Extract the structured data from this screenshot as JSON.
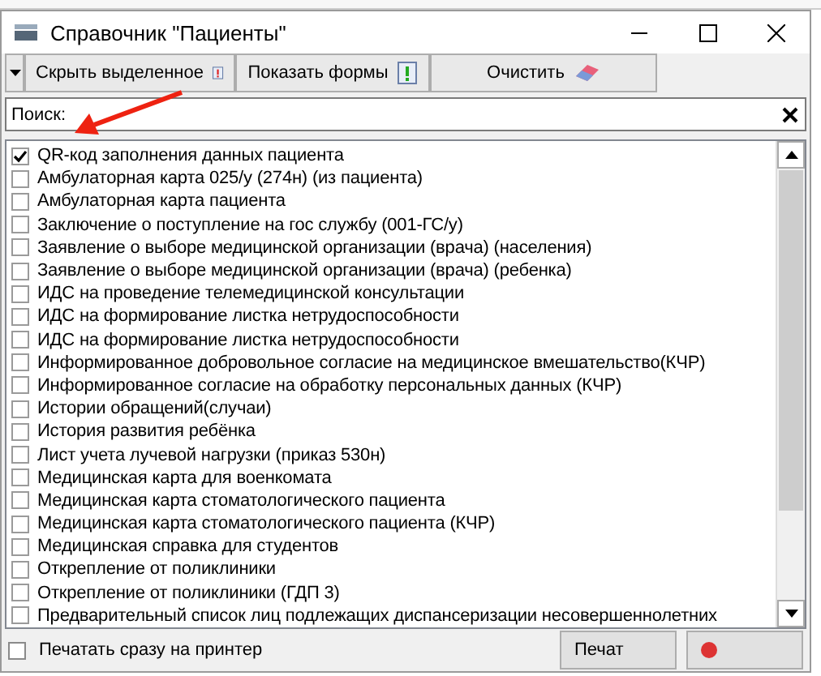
{
  "window": {
    "title": "Справочник \"Пациенты\""
  },
  "toolbar": [
    {
      "label": "Скрыть выделенное",
      "kind": "hide"
    },
    {
      "label": "Показать формы",
      "kind": "show"
    },
    {
      "label": "Очистить",
      "kind": "clear"
    }
  ],
  "search": {
    "label": "Поиск:"
  },
  "items": [
    {
      "label": "QR-код заполнения данных пациента",
      "checked": true
    },
    {
      "label": "Амбулаторная карта 025/у (274н) (из пациента)",
      "checked": false
    },
    {
      "label": "Амбулаторная карта пациента",
      "checked": false
    },
    {
      "label": "Заключение о поступление на гос службу (001-ГС/у)",
      "checked": false
    },
    {
      "label": "Заявление о выборе медицинской организации (врача) (населения)",
      "checked": false
    },
    {
      "label": "Заявление о выборе медицинской организации (врача) (ребенка)",
      "checked": false
    },
    {
      "label": "ИДС на проведение телемедицинской консультации",
      "checked": false
    },
    {
      "label": "ИДС на формирование листка нетрудоспособности",
      "checked": false
    },
    {
      "label": "ИДС на формирование листка нетрудоспособности",
      "checked": false
    },
    {
      "label": "Информированное добровольное согласие на медицинское вмешательство(КЧР)",
      "checked": false
    },
    {
      "label": "Информированное согласие на обработку персональных данных (КЧР)",
      "checked": false
    },
    {
      "label": "Истории обращений(случаи)",
      "checked": false
    },
    {
      "label": "История развития ребёнка",
      "checked": false
    },
    {
      "label": "Лист учета лучевой нагрузки (приказ 530н)",
      "checked": false
    },
    {
      "label": "Медицинская карта для военкомата",
      "checked": false
    },
    {
      "label": "Медицинская карта стоматологического пациента",
      "checked": false
    },
    {
      "label": "Медицинская карта стоматологического пациента (КЧР)",
      "checked": false
    },
    {
      "label": "Медицинская справка для студентов",
      "checked": false
    },
    {
      "label": "Открепление от поликлиники",
      "checked": false
    },
    {
      "label": "Открепление от поликлиники (ГДП 3)",
      "checked": false
    },
    {
      "label": "Предварительный список лиц подлежащих диспансеризации несовершеннолетних",
      "checked": false
    }
  ],
  "print_directly": {
    "label": "Печатать сразу на принтер",
    "checked": false
  },
  "buttons": [
    {
      "label": "Печат",
      "kind": "print"
    },
    {
      "kind": "stop"
    }
  ]
}
